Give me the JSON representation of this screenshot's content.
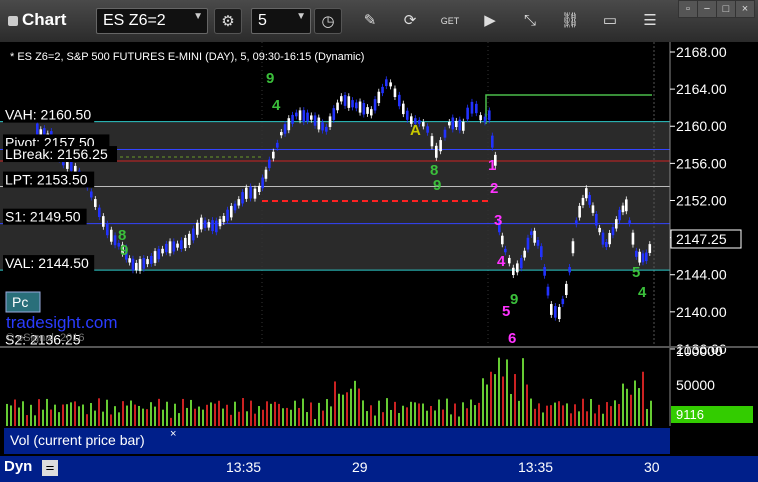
{
  "toolbar": {
    "title": "Chart",
    "symbol": "ES Z6=2",
    "interval": "5",
    "get_label": "GET"
  },
  "chart": {
    "header": "* ES Z6=2, S&P 500 FUTURES E-MINI (DAY), 5, 09:30-16:15 (Dynamic)",
    "watermark_main": "tradesight.com",
    "copyright": "© eSignal, 2016",
    "pc_label": "Pc",
    "last_price": "2147.25",
    "price_ticks": [
      "2168.00",
      "2164.00",
      "2160.00",
      "2156.00",
      "2152.00",
      "2148.00",
      "2144.00",
      "2140.00",
      "2136.00"
    ],
    "levels": [
      {
        "label": "VAH: 2160.50",
        "price": 2160.5,
        "color": "#2ec8c8"
      },
      {
        "label": "Pivot: 2157.50",
        "price": 2157.5,
        "color": "#3344ff"
      },
      {
        "label": "LBreak: 2156.25",
        "price": 2156.25,
        "color": "#cc2222"
      },
      {
        "label": "LPT: 2153.50",
        "price": 2153.5,
        "color": "#bbbbbb"
      },
      {
        "label": "S1: 2149.50",
        "price": 2149.5,
        "color": "#3344ff"
      },
      {
        "label": "VAL: 2144.50",
        "price": 2144.5,
        "color": "#2ec8c8"
      },
      {
        "label": "S2: 2136.25",
        "price": 2136.25,
        "color": "#3344ff"
      }
    ]
  },
  "volume": {
    "ticks": [
      "100000",
      "50000"
    ],
    "last_value": "9116",
    "legend": "Vol (current price bar)",
    "close_glyph": "×"
  },
  "time_axis": {
    "label_dyn": "Dyn",
    "labels": [
      "13:35",
      "29",
      "13:35",
      "30"
    ]
  },
  "colors": {
    "up_bar": "#ffffff",
    "down_bar": "#2233ff",
    "vol_up": "#66cc33",
    "vol_down": "#cc2222",
    "axis_bg": "#001f8a",
    "last_price_box": "#33cc00"
  }
}
